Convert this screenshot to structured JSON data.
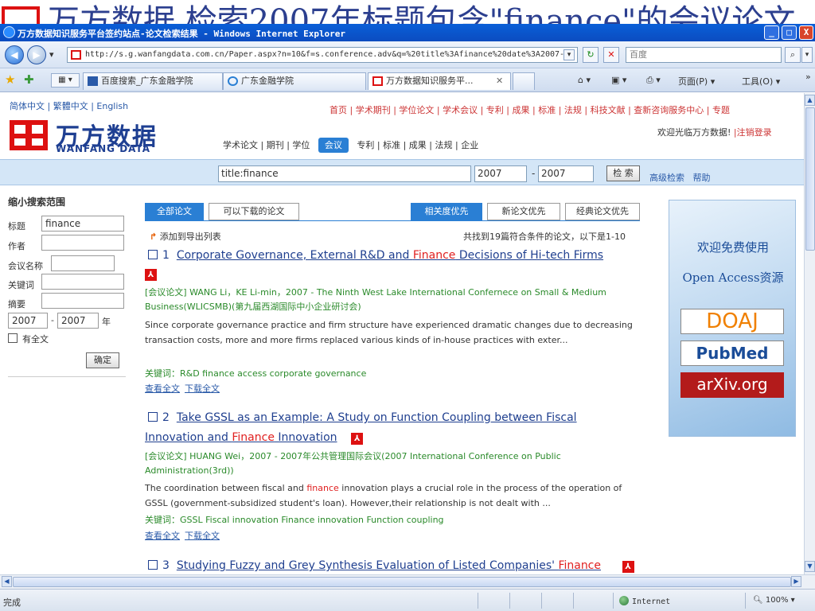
{
  "background": {
    "slide_title_fragment": "万方数据 检索2007年标题包含\"finance\"的会议论文"
  },
  "window": {
    "title": "万方数据知识服务平台签约站点-论文检索结果 - Windows Internet Explorer",
    "minimize": "_",
    "maximize": "□",
    "close": "X"
  },
  "toolbar": {
    "back": "◀",
    "forward": "▶",
    "dropdown": "▾",
    "address": "http://s.g.wanfangdata.com.cn/Paper.aspx?n=10&f=s.conference.adv&q=%20title%3Afinance%20date%3A2007-",
    "refresh": "↻",
    "stop": "✕",
    "search_placeholder": "百度",
    "search_go": "⌕"
  },
  "tabs": [
    {
      "label": "百度搜索_广东金融学院"
    },
    {
      "label": "广东金融学院"
    },
    {
      "label": "万方数据知识服务平...",
      "close": "✕"
    }
  ],
  "tools": {
    "home": "⌂ ▾",
    "feeds": "▣ ▾",
    "print": "⎙ ▾",
    "page": "页面(P) ▾",
    "tools": "工具(O) ▾",
    "more": "»"
  },
  "header": {
    "languages": "简体中文 | 繁體中文 | English",
    "logo_cn": "万方数据",
    "logo_en": "WANFANG DATA",
    "topnav": "首页 | 学术期刊 | 学位论文 | 学术会议 | 专利 | 成果 | 标准 | 法规 | 科技文献 | 查新咨询服务中心 | 专题",
    "welcome": "欢迎光临万方数据!",
    "logout": "|注销登录",
    "catnav_before": "学术论文 | 期刊 | 学位",
    "catnav_selected": "会议",
    "catnav_after": "专利 | 标准 | 成果 | 法规 | 企业"
  },
  "searchbar": {
    "query": "title:finance",
    "year_from": "2007",
    "dash": "-",
    "year_to": "2007",
    "go": "检 索",
    "advanced": "高级检索",
    "help": "帮助"
  },
  "leftpanel": {
    "title": "缩小搜索范围",
    "title_label": "标题",
    "title_value": "finance",
    "author_label": "作者",
    "conf_label": "会议名称",
    "keyword_label": "关键词",
    "abstract_label": "摘要",
    "year_from": "2007",
    "year_to": "2007",
    "dash": "-",
    "year_unit": "年",
    "fulltext_label": "有全文",
    "ok": "确定"
  },
  "results": {
    "tab_all": "全部论文",
    "tab_download": "可以下载的论文",
    "sort_relevance": "相关度优先",
    "sort_new": "新论文优先",
    "sort_classic": "经典论文优先",
    "export": "添加到导出列表",
    "found": "共找到19篇符合条件的论文，以下是1-10",
    "items": [
      {
        "num": "1",
        "title_a": "Corporate Governance, External R&D and ",
        "title_hl": "Finance",
        "title_b": " Decisions of Hi-tech Firms",
        "meta": "[会议论文] WANG Li，KE Li-min，2007 - The Ninth West Lake International Confernece on Small & Medium Business(WLICSMB)(第九届西湖国际中小企业研讨会)",
        "abstract": "Since corporate governance practice and firm structure have experienced dramatic changes due to decreasing transaction costs, more and more firms replaced various kinds of in-house practices with exter...",
        "keywords": "关键词：R&D finance access corporate governance",
        "view": "查看全文",
        "download": "下载全文"
      },
      {
        "num": "2",
        "title_a": "Take GSSL as an Example: A Study on Function Coupling between Fiscal",
        "title_a2": "Innovation and ",
        "title_hl": "Finance",
        "title_b": " Innovation",
        "meta": "[会议论文] HUANG Wei，2007 - 2007年公共管理国际会议(2007 International Conference on Public Administration(3rd))",
        "abstract_a": "The coordination between fiscal and ",
        "abstract_hl": "finance",
        "abstract_b": " innovation plays a crucial role in the process of the operation of GSSL (government-subsidized student's loan). However,their relationship is not dealt with ...",
        "keywords": "关键词：GSSL Fiscal innovation Finance innovation Function coupling",
        "view": "查看全文",
        "download": "下载全文"
      },
      {
        "num": "3",
        "title_a": "Studying Fuzzy and Grey Synthesis Evaluation of Listed Companies' ",
        "title_hl": "Finance"
      }
    ],
    "pdf": "⅄"
  },
  "ad": {
    "welcome": "欢迎免费使用",
    "oa": "Open Access资源",
    "doaj": "DOAJ",
    "pubmed": "PubMed",
    "arxiv": "arXiv.org"
  },
  "status": {
    "text": "完成",
    "zone": "Internet",
    "zoom": "100%"
  },
  "colors": {
    "accent": "#2a7fd4",
    "brand_red": "#d11111",
    "brand_blue": "#1e3f92",
    "highlight": "#e02020"
  }
}
